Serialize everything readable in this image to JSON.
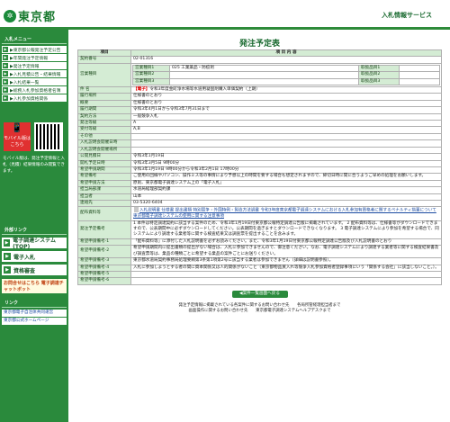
{
  "header": {
    "logo": "東京都",
    "system_title": "入札情報サービス"
  },
  "sidebar": {
    "menu_heading": "入札メニュー",
    "items": [
      "▶東京都公報発注予定公告",
      "▶年間発注予定情報",
      "▶発注予定情報",
      "▶入札見積公告・結果情報",
      "▶入札結果一覧",
      "▶総務入札参加資格者名簿",
      "▶入札参加資格関係"
    ],
    "mobile_label": "モバイル版はこちら",
    "mobile_note": "モバイル版は、発注予定情報と入札（見積）結果情報のみ閲覧できます。",
    "external_heading": "外部リンク",
    "big_items": [
      "電子調達システム(TOP)",
      "電子入札",
      "資格審査"
    ],
    "banner": "お問合せはこちら 電子調達チャットボット",
    "links_heading": "リンク",
    "links": [
      "東京都電子自治体共同運営",
      "東京都公式ホームページ"
    ]
  },
  "page": {
    "title": "発注予定表"
  },
  "table": {
    "head_item": "項目",
    "head_content": "項 目 内 容",
    "rows": [
      {
        "label": "契約番号",
        "value": "02-01316"
      },
      {
        "label": "営業種目",
        "value": "営業種目1 025 工業薬品・防疫剤"
      },
      {
        "label": "件 名",
        "prefix": "【電子】",
        "value": "令和3年度金町浄水場等水道用凝固剤購入単価契約（上期）"
      },
      {
        "label": "履行場所",
        "value": "仕様書のとおり"
      },
      {
        "label": "概要",
        "value": "仕様書のとおり"
      },
      {
        "label": "履行期間",
        "value": "令和3年4月1日から令和3年7月31日まで"
      },
      {
        "label": "契約方法",
        "value": "一般競争入札"
      },
      {
        "label": "発注等級",
        "value": "A"
      },
      {
        "label": "受付等級",
        "value": "A,B"
      },
      {
        "label": "その他",
        "value": ""
      },
      {
        "label": "入札説明会開催日時",
        "value": ""
      },
      {
        "label": "入札説明会開催場所",
        "value": ""
      },
      {
        "label": "公開見積日",
        "value": "令和3年1月19日"
      },
      {
        "label": "開札予定日時",
        "value": "令和3年3月5日 9時00分"
      },
      {
        "label": "希望申請期間",
        "value": "令和3年1月19日 9時00分から令和3年2月1日 17時00分"
      },
      {
        "label": "希望備考",
        "value": "ご使用の回線やパソコン、操作ミス等の事情により予想以上の時間を要する場合も想定されますので、締切日時に間に合うようご早めの処理をお願いします。"
      },
      {
        "label": "希望申請方法",
        "value": "原則、東京都電子調達システム上の「電子入札」"
      },
      {
        "label": "担当局部課",
        "value": "水道局経理部契約課"
      },
      {
        "label": "担当者",
        "value": "山本"
      },
      {
        "label": "連絡先",
        "value": "03-5320-6404"
      },
      {
        "label": "配布資料等",
        "value": "入札説明書 仕様書 提出書類 特別競争・外国特例・製造方法調書 令和3年度東京都電子調達システムにおける入札参加有資格者に関するペナルティ措置について 東京都電子調達システムの使用に関する注意事項"
      },
      {
        "label": "発注予定備考",
        "value": "1 本件は特定調達契約に該当する案件のため、令和3年1月19日付東京都公報特定調達公告版に掲載されています。 2 配布資料等は、仕様書等がダウンロードできますので、公表期間中に必ずダウンロードしてください。公表期間を過ぎますとダウンロードできなくなります。 3 電子調達システムにより参加を希望する場合で、同システムにより調達する業者等に関する検査結果又は調査票を提出することを含みます。"
      },
      {
        "label": "希望申請備考-1",
        "value": "「配布資料等」に添付した入札説明書を必ずお読みください。また、令和3年1月19日付東京都公報特定調達公告版及び入札説明書のとおり"
      },
      {
        "label": "希望申請備考-2",
        "value": "希望申請期間内に提出書類の提出がない場合は、入札に参加できませんので、御注意ください。なお、電子調達システムにより調達する業者等に関する検査結果書及び調査票等は、業品の種類ごとに希望する業品の案件ごとにお送りください。"
      },
      {
        "label": "希望申請備考-3",
        "value": "東京都水道局契約事務局処理要綱第3条第1項第2号に該当する業者は参加できません（詳細は説明書参照）。"
      },
      {
        "label": "希望申請備考-4",
        "value": "入札に参加しようとする者の間に資本関係又は人的関係がないこと（東京都物品買入れ等競争入札参加資格者登録事項にいう「関係する会社」に該当しないこと。）。"
      },
      {
        "label": "希望申請備考-5",
        "value": ""
      },
      {
        "label": "希望申請備考-6",
        "value": ""
      }
    ],
    "biz_sub": [
      {
        "k": "営業種目1",
        "v": "025 工業薬品・防疫剤",
        "k2": "取扱品目1",
        "v2": ""
      },
      {
        "k": "営業種目2",
        "v": "",
        "k2": "取扱品目2",
        "v2": ""
      },
      {
        "k": "営業種目3",
        "v": "",
        "k2": "取扱品目3",
        "v2": ""
      }
    ]
  },
  "footer": {
    "back_button": "◀案件一覧画面へ戻る",
    "line1": "発注予定情報に掲載されている各案件に関するお問い合わせ先　　各局所管経理担当者まで",
    "line2": "画面操作に関するお問い合わせ先　　東京都電子調達システムヘルプデスクまで"
  }
}
